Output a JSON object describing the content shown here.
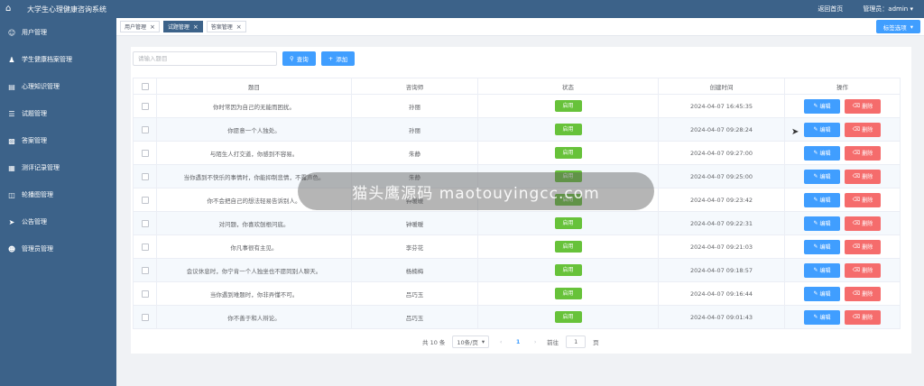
{
  "header": {
    "title": "大学生心理健康咨询系统",
    "home_link": "返回首页",
    "admin_label": "管理员：admin",
    "dropdown_arrow": "▾"
  },
  "sidebar": {
    "items": [
      {
        "label": "用户管理",
        "icon": "user-icon"
      },
      {
        "label": "学生健康档案管理",
        "icon": "person-icon"
      },
      {
        "label": "心理知识管理",
        "icon": "document-icon"
      },
      {
        "label": "试题管理",
        "icon": "list-icon"
      },
      {
        "label": "答案管理",
        "icon": "chart-icon"
      },
      {
        "label": "测评记录管理",
        "icon": "table-icon"
      },
      {
        "label": "轮播图管理",
        "icon": "slider-icon"
      },
      {
        "label": "公告管理",
        "icon": "send-icon"
      },
      {
        "label": "管理员管理",
        "icon": "admin-icon"
      }
    ]
  },
  "tabs": {
    "items": [
      {
        "label": "用户管理",
        "active": false
      },
      {
        "label": "试题管理",
        "active": true
      },
      {
        "label": "答案管理",
        "active": false
      }
    ],
    "close_symbol": "×",
    "options_label": "标签选项"
  },
  "toolbar": {
    "search_placeholder": "请输入题目",
    "search_label": "查询",
    "add_label": "添加"
  },
  "table": {
    "columns": [
      "题目",
      "咨询师",
      "状态",
      "创建时间",
      "操作"
    ],
    "edit_label": "编辑",
    "delete_label": "删除",
    "rows": [
      {
        "question": "你时常因为自己的无能而困扰。",
        "counselor": "孙丽",
        "status": "启用",
        "created": "2024-04-07 16:45:35"
      },
      {
        "question": "你愿意一个人独处。",
        "counselor": "孙丽",
        "status": "启用",
        "created": "2024-04-07 09:28:24"
      },
      {
        "question": "与陌生人打交道，你感到不容易。",
        "counselor": "朱静",
        "status": "启用",
        "created": "2024-04-07 09:27:00"
      },
      {
        "question": "当你遇到不快乐的事情时，你能抑制悲情，不露声色。",
        "counselor": "朱静",
        "status": "启用",
        "created": "2024-04-07 09:25:00"
      },
      {
        "question": "你不会把自己的想法轻易告诉别人。",
        "counselor": "钟暖暖",
        "status": "启用",
        "created": "2024-04-07 09:23:42"
      },
      {
        "question": "对问题，你喜欢刨根问底。",
        "counselor": "钟暖暖",
        "status": "启用",
        "created": "2024-04-07 09:22:31"
      },
      {
        "question": "你凡事很有主见。",
        "counselor": "李芬花",
        "status": "启用",
        "created": "2024-04-07 09:21:03"
      },
      {
        "question": "会议休息时，你宁肯一个人独坐也不愿同别人聊天。",
        "counselor": "杨楠梅",
        "status": "启用",
        "created": "2024-04-07 09:18:57"
      },
      {
        "question": "当你遇到难题时，你非弄懂不可。",
        "counselor": "吕巧玉",
        "status": "启用",
        "created": "2024-04-07 09:16:44"
      },
      {
        "question": "你不善于和人辩论。",
        "counselor": "吕巧玉",
        "status": "启用",
        "created": "2024-04-07 09:01:43"
      }
    ]
  },
  "pagination": {
    "total": "共 10 条",
    "page_size": "10条/页",
    "prev": "‹",
    "current": "1",
    "next": "›",
    "goto_label": "前往",
    "goto_value": "1",
    "page_unit": "页"
  },
  "watermark": "猫头鹰源码 maotouyingcc.com",
  "colors": {
    "nav_bg": "#3c6289",
    "primary": "#409eff",
    "success": "#67c23a",
    "danger": "#f56c6c"
  }
}
